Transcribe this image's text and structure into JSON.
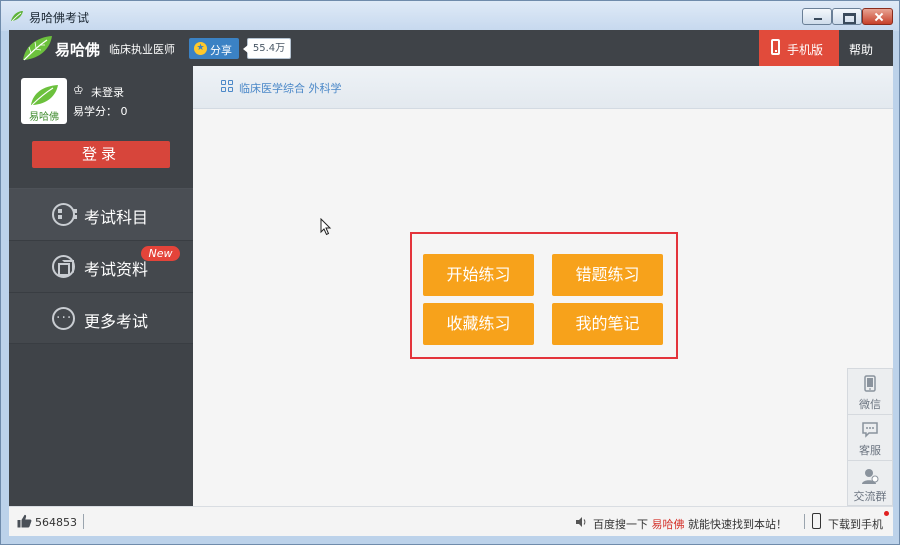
{
  "window": {
    "title": "易哈佛考试"
  },
  "header": {
    "brand": "易哈佛",
    "subtitle": "临床执业医师",
    "share_label": "分享",
    "share_count": "55.4万",
    "mobile_label": "手机版",
    "help_label": "帮助"
  },
  "sidebar": {
    "avatar_text": "易哈佛",
    "status": "未登录",
    "score": "易学分： 0",
    "login_label": "登录",
    "items": [
      {
        "label": "考试科目",
        "icon": "grid-icon"
      },
      {
        "label": "考试资料",
        "icon": "document-icon",
        "badge": "New"
      },
      {
        "label": "更多考试",
        "icon": "more-icon"
      }
    ]
  },
  "main": {
    "breadcrumb": "临床医学综合 外科学",
    "actions": [
      "开始练习",
      "错题练习",
      "收藏练习",
      "我的笔记"
    ]
  },
  "float_panel": {
    "items": [
      {
        "label": "微信",
        "icon": "wechat-icon"
      },
      {
        "label": "客服",
        "icon": "chat-icon"
      },
      {
        "label": "交流群",
        "icon": "group-icon"
      }
    ]
  },
  "statusbar": {
    "like_count": "564853",
    "promo_prefix": "百度搜一下 ",
    "promo_brand": "易哈佛",
    "promo_suffix": " 就能快速找到本站！",
    "download_label": "下载到手机"
  },
  "colors": {
    "accent_red": "#e14b3b",
    "action_orange": "#f7a21b",
    "sidebar_bg": "#3f4348",
    "link_blue": "#4b88c8"
  }
}
